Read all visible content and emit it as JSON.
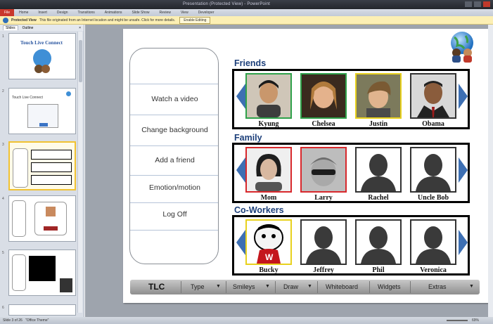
{
  "window": {
    "title": "Presentation (Protected View) - PowerPoint"
  },
  "menubar": {
    "items": [
      "File",
      "Home",
      "Insert",
      "Design",
      "Transitions",
      "Animations",
      "Slide Show",
      "Review",
      "View",
      "Developer"
    ]
  },
  "protected_bar": {
    "label": "Protected View",
    "message": "This file originated from an Internet location and might be unsafe. Click for more details.",
    "enable_button": "Enable Editing"
  },
  "panel": {
    "tabs": [
      "Slides",
      "Outline"
    ],
    "close": "×"
  },
  "slides": [
    {
      "num": "1",
      "title": "Touch Live Connect"
    },
    {
      "num": "2",
      "title": "Touch Live Connect"
    },
    {
      "num": "3",
      "title": ""
    },
    {
      "num": "4",
      "title": ""
    },
    {
      "num": "5",
      "title": ""
    },
    {
      "num": "6",
      "title": ""
    }
  ],
  "menu": {
    "buttons": [
      "Watch a video",
      "Change background",
      "Add a friend",
      "Emotion/motion",
      "Log Off"
    ]
  },
  "sections": {
    "friends": {
      "title": "Friends",
      "people": [
        "Kyung",
        "Chelsea",
        "Justin",
        "Obama"
      ]
    },
    "family": {
      "title": "Family",
      "people": [
        "Mom",
        "Larry",
        "Rachel",
        "Uncle Bob"
      ]
    },
    "coworkers": {
      "title": "Co-Workers",
      "people": [
        "Bucky",
        "Jeffrey",
        "Phil",
        "Veronica"
      ]
    }
  },
  "toolbar": {
    "tlc": "TLC",
    "type": "Type",
    "smileys": "Smileys",
    "draw": "Draw",
    "whiteboard": "Whiteboard",
    "widgets": "Widgets",
    "extras": "Extras",
    "caret": "▼"
  },
  "statusbar": {
    "slide": "Slide 3 of 26",
    "theme": "\"Office Theme\"",
    "zoom": "69%"
  },
  "colors": {
    "section_title": "#1c3f7a",
    "arrow": "#3d6fb3",
    "green_border": "#2fa14a",
    "yellow_border": "#e8d11e",
    "red_border": "#d8282c"
  }
}
